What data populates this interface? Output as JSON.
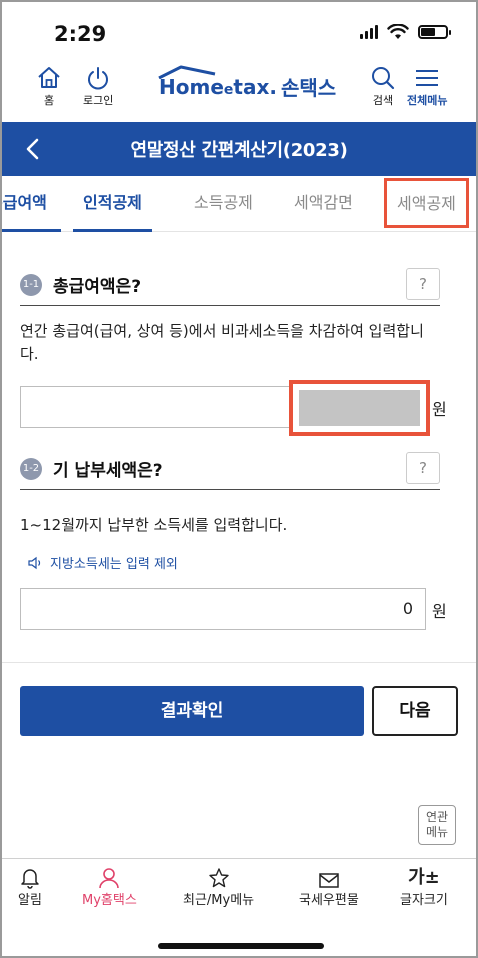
{
  "status": {
    "time": "2:29"
  },
  "header": {
    "home_label": "홈",
    "login_label": "로그인",
    "brand_home": "Home",
    "brand_tax": "tax",
    "brand_e": "e",
    "brand_dot": ".",
    "brand_son": "손택스",
    "search_label": "검색",
    "menu_label": "전체메뉴"
  },
  "titlebar": {
    "title": "연말정산 간편계산기(2023)"
  },
  "tabs": [
    {
      "label": "총급여액"
    },
    {
      "label": "인적공제"
    },
    {
      "label": "소득공제"
    },
    {
      "label": "세액감면"
    },
    {
      "label": "세액공제"
    }
  ],
  "section1": {
    "num": "1-1",
    "title": "총급여액은?",
    "help": "?",
    "desc": "연간 총급여(급여, 상여 등)에서 비과세소득을 차감하여 입력합니다.",
    "unit": "원"
  },
  "section2": {
    "num": "1-2",
    "title": "기 납부세액은?",
    "help": "?",
    "desc": "1~12월까지 납부한 소득세를 입력합니다.",
    "note": "지방소득세는 입력 제외",
    "value": "0",
    "unit": "원"
  },
  "actions": {
    "confirm": "결과확인",
    "next": "다음"
  },
  "related": {
    "line1": "연관",
    "line2": "메뉴"
  },
  "bottom_nav": [
    {
      "label": "알림",
      "icon": "bell-icon"
    },
    {
      "label": "My홈택스",
      "icon": "person-icon"
    },
    {
      "label": "최근/My메뉴",
      "icon": "star-icon"
    },
    {
      "label": "국세우편물",
      "icon": "mail-icon"
    },
    {
      "label": "글자크기",
      "icon": "font-size-icon",
      "glyph": "가±"
    }
  ],
  "colors": {
    "brand": "#1e4fa3",
    "highlight": "#e8533a",
    "active_nav": "#e0426a"
  }
}
